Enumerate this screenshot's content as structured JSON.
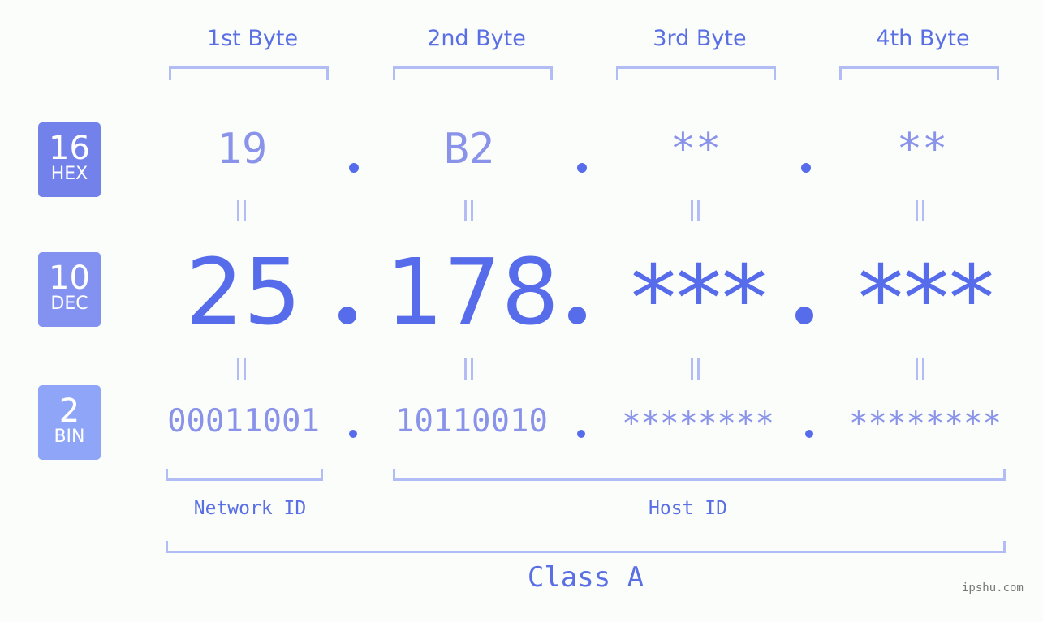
{
  "bytes": {
    "headers": [
      "1st Byte",
      "2nd Byte",
      "3rd Byte",
      "4th Byte"
    ],
    "hex": [
      "19",
      "B2",
      "**",
      "**"
    ],
    "dec": [
      "25",
      "178",
      "***",
      "***"
    ],
    "bin": [
      "00011001",
      "10110010",
      "********",
      "********"
    ]
  },
  "badges": {
    "hex": {
      "number": "16",
      "label": "HEX",
      "color": "#7382ea"
    },
    "dec": {
      "number": "10",
      "label": "DEC",
      "color": "#8392f1"
    },
    "bin": {
      "number": "2",
      "label": "BIN",
      "color": "#8ea5f8"
    }
  },
  "labels": {
    "network_id": "Network ID",
    "host_id": "Host ID",
    "class": "Class A"
  },
  "watermark": "ipshu.com",
  "colors": {
    "accent": "#566cea",
    "light": "#8a93ea",
    "bracket": "#b3bdf5"
  }
}
